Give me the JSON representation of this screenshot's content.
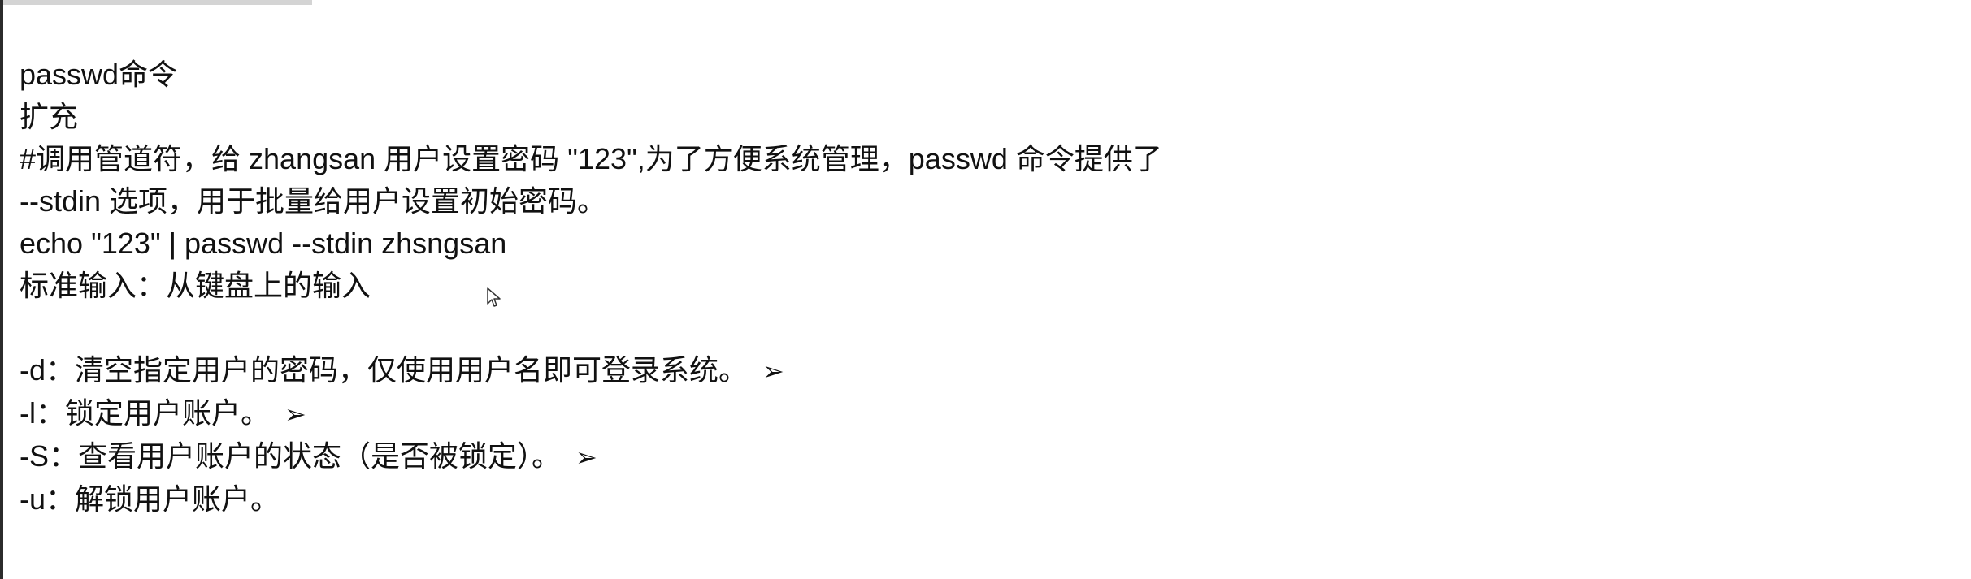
{
  "document": {
    "lines": {
      "title": "passwd命令",
      "section": "扩充",
      "comment": "#调用管道符，给 zhangsan 用户设置密码 \"123\",为了方便系统管理，passwd 命令提供了 --stdin 选项，用于批量给用户设置初始密码。",
      "command": "echo \"123\" | passwd --stdin zhsngsan",
      "note": "标准输入：从键盘上的输入"
    },
    "options": [
      {
        "text": "-d：清空指定用户的密码，仅使用用户名即可登录系统。",
        "arrow": "➢"
      },
      {
        "text": "-l：锁定用户账户。",
        "arrow": "➢"
      },
      {
        "text": "-S：查看用户账户的状态（是否被锁定）。",
        "arrow": "➢"
      },
      {
        "text": "-u：解锁用户账户。",
        "arrow": ""
      }
    ]
  },
  "icons": {
    "cursor": "mouse-pointer-icon",
    "arrow": "arrow-bullet-icon"
  }
}
